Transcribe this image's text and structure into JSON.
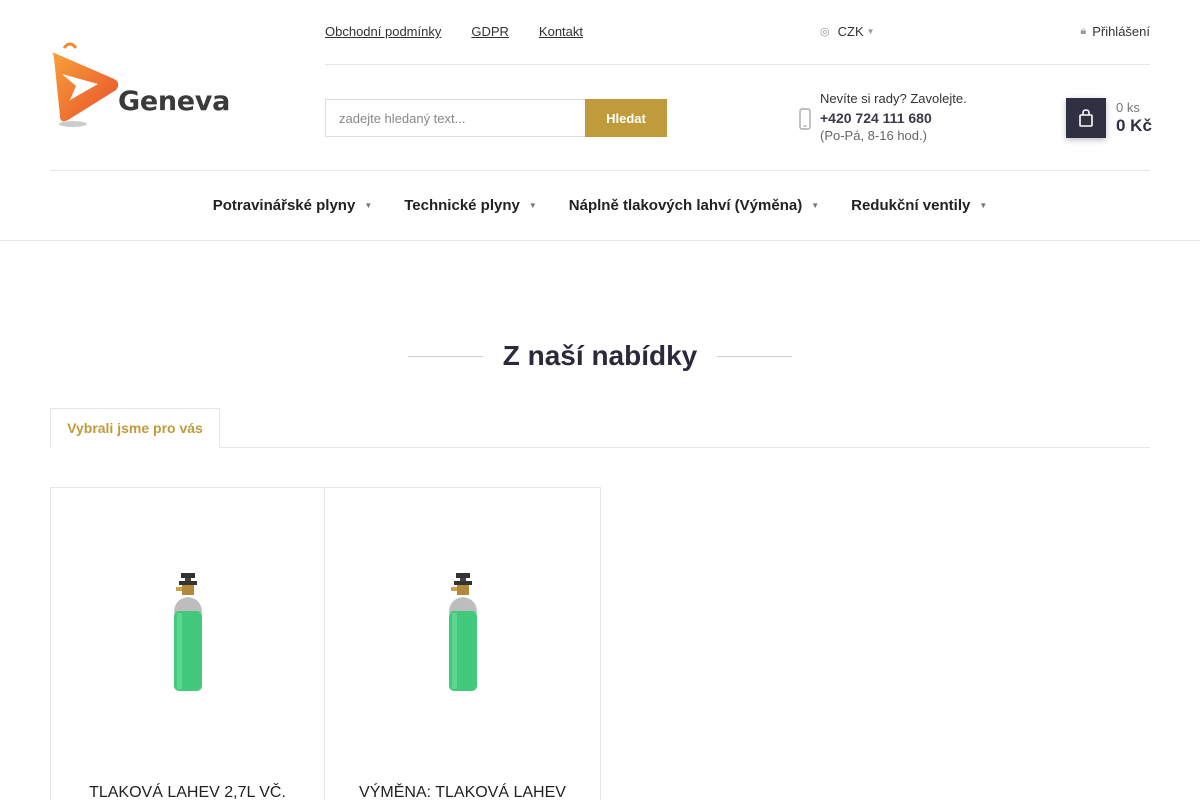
{
  "brand": {
    "name": "Geneva"
  },
  "top_links": [
    "Obchodní podmínky",
    "GDPR",
    "Kontakt"
  ],
  "currency": {
    "value": "CZK",
    "icon": "coins-icon"
  },
  "login": {
    "label": "Přihlášení",
    "icon": "lock-icon"
  },
  "search": {
    "placeholder": "zadejte hledaný text...",
    "button_label": "Hledat"
  },
  "help": {
    "question": "Nevíte si rady? Zavolejte.",
    "phone": "+420 724 111 680",
    "hours": "(Po-Pá, 8-16 hod.)"
  },
  "cart": {
    "quantity": "0 ks",
    "total": "0 Kč",
    "icon": "cart-icon"
  },
  "nav": [
    {
      "label": "Potravinářské plyny"
    },
    {
      "label": "Technické plyny"
    },
    {
      "label": "Náplně tlakových lahví (Výměna)"
    },
    {
      "label": "Redukční ventily"
    }
  ],
  "section": {
    "title": "Z naší nabídky",
    "tab_label": "Vybrali jsme pro vás"
  },
  "products": [
    {
      "name": "TLAKOVÁ LAHEV 2,7L VČ."
    },
    {
      "name": "VÝMĚNA: TLAKOVÁ LAHEV"
    }
  ],
  "colors": {
    "accent": "#bf9b3b",
    "dark": "#2f3142",
    "logo_orange": "#f0662a"
  }
}
